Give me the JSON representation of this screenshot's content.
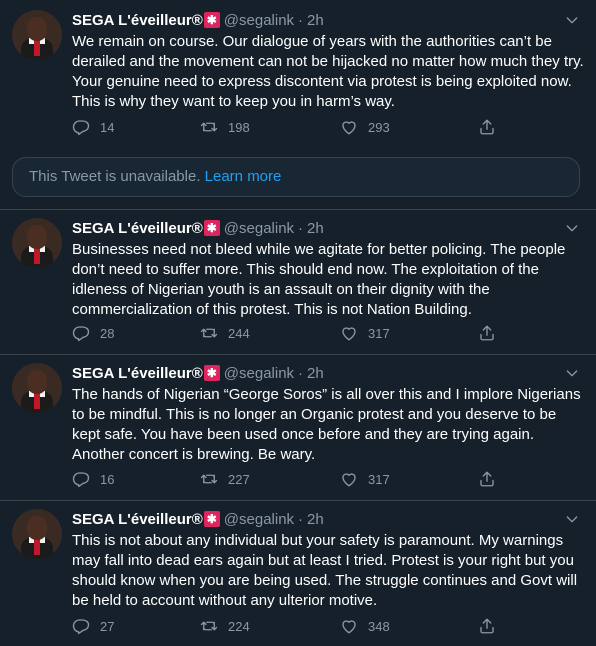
{
  "tweets": [
    {
      "name": "SEGA L'éveilleur®",
      "handle": "@segalink",
      "time": "2h",
      "text": "We remain on course. Our dialogue of years with the authorities can’t be derailed and the movement can not be hijacked no matter how much they try. Your genuine need to express discontent via protest is being exploited now. This is why they want to keep you in harm’s way.",
      "replies": "14",
      "retweets": "198",
      "likes": "293"
    },
    {
      "name": "SEGA L'éveilleur®",
      "handle": "@segalink",
      "time": "2h",
      "text": "Businesses need not bleed while we agitate for better policing. The people don’t need to suffer more. This should end now. The exploitation of the idleness of Nigerian youth is an assault on their dignity with the commercialization of this protest. This is not Nation Building.",
      "replies": "28",
      "retweets": "244",
      "likes": "317"
    },
    {
      "name": "SEGA L'éveilleur®",
      "handle": "@segalink",
      "time": "2h",
      "text": "The hands of Nigerian “George Soros” is all over this and I implore Nigerians to be mindful. This is no longer an Organic protest and you deserve to be kept safe. You have been used once before and they are trying again. Another concert is brewing. Be wary.",
      "replies": "16",
      "retweets": "227",
      "likes": "317"
    },
    {
      "name": "SEGA L'éveilleur®",
      "handle": "@segalink",
      "time": "2h",
      "text": "This is not about any individual but your safety is paramount. My warnings may fall into dead ears again but at least I tried. Protest is your right but you should know when you are being used. The struggle continues and Govt will be held to account without any ulterior motive.",
      "replies": "27",
      "retweets": "224",
      "likes": "348"
    }
  ],
  "unavailable": {
    "message": "This Tweet is unavailable.",
    "link": "Learn more"
  },
  "colors": {
    "background": "#15202b",
    "secondary_text": "#8899a6",
    "link": "#1da1f2",
    "divider": "#38444d"
  },
  "icons": [
    "reply-icon",
    "retweet-icon",
    "like-icon",
    "share-icon",
    "chevron-down-icon",
    "siren-emoji-icon"
  ]
}
